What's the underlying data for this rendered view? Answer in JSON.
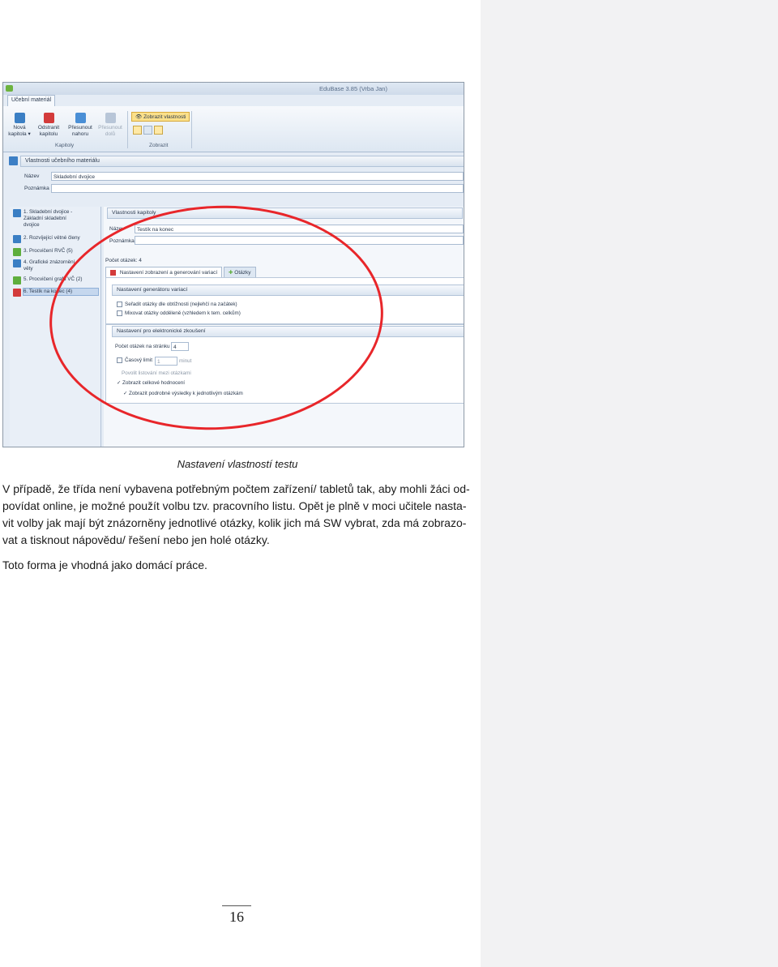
{
  "figure": {
    "app_title": "EduBase 3.85 (Vrba Jan)",
    "ribbon_tab": "Učební materiál",
    "buttons": [
      {
        "line1": "Nová",
        "line2": "kapitola ▾"
      },
      {
        "line1": "Odstranit",
        "line2": "kapitolu"
      },
      {
        "line1": "Přesunout",
        "line2": "nahoru"
      },
      {
        "line1": "Přesunout",
        "line2": "dolů"
      }
    ],
    "show_props_button": "Zobrazit vlastnosti",
    "group_chapters": "Kapitoly",
    "group_view": "Zobrazit",
    "material_props_header": "Vlastnosti učebního materiálu",
    "label_name": "Název",
    "material_name": "Skladební dvojice",
    "label_note": "Poznámka",
    "tree": [
      {
        "line1": "1. Skladební dvojice -",
        "line2": "Základní skladební",
        "line3": "dvojice"
      },
      {
        "line1": "2. Rozvíjející větné členy"
      },
      {
        "line1": "3. Procvičení RVČ (5)"
      },
      {
        "line1": "4. Grafické znázornění",
        "line2": "věty"
      },
      {
        "line1": "5. Procvičení grafů VČ (2)"
      },
      {
        "line1": "6. Testík na konec (4)"
      }
    ],
    "chapter_props_header": "Vlastnosti kapitoly",
    "chapter_name": "Testík na konec",
    "question_count": "Počet otázek: 4",
    "tab_variants": "Nastavení zobrazení a generování variací",
    "tab_questions": "Otázky",
    "generator_header": "Nastavení generátoru variací",
    "opt_sort": "Seřadit otázky dle obtížnosti (nejlehčí na začátek)",
    "opt_mix": "Mixovat otázky odděleně (vzhledem k tem. celkům)",
    "exam_header": "Nastavení pro elektronické zkoušení",
    "per_page_label": "Počet otázek na stránku",
    "per_page_value": "4",
    "time_limit_label": "Časový limit",
    "time_limit_value": "1",
    "time_limit_unit": "minut",
    "opt_allow_browse": "Povolit listování mezi otázkami",
    "opt_overall": "Zobrazit celkové hodnocení",
    "opt_detailed": "Zobrazit podrobné výsledky k jednotlivým otázkám"
  },
  "caption": "Nastavení vlastností testu",
  "paragraph1": [
    "V případě, že třída není vybavena potřebným počtem zařízení/ tabletů tak, aby mohli žáci od-",
    "povídat online, je možné použít volbu tzv. pracovního listu. Opět je plně v moci učitele nasta-",
    "vit volby jak mají být znázorněny jednotlivé otázky, kolik jich má SW vybrat, zda má zobrazo-",
    "vat a tisknout nápovědu/ řešení nebo jen holé otázky."
  ],
  "paragraph2": "Toto forma je vhodná jako domácí práce.",
  "page_number": "16",
  "colors": {
    "highlight_circle": "#e8262a",
    "side_panel": "#f2f2f3"
  }
}
